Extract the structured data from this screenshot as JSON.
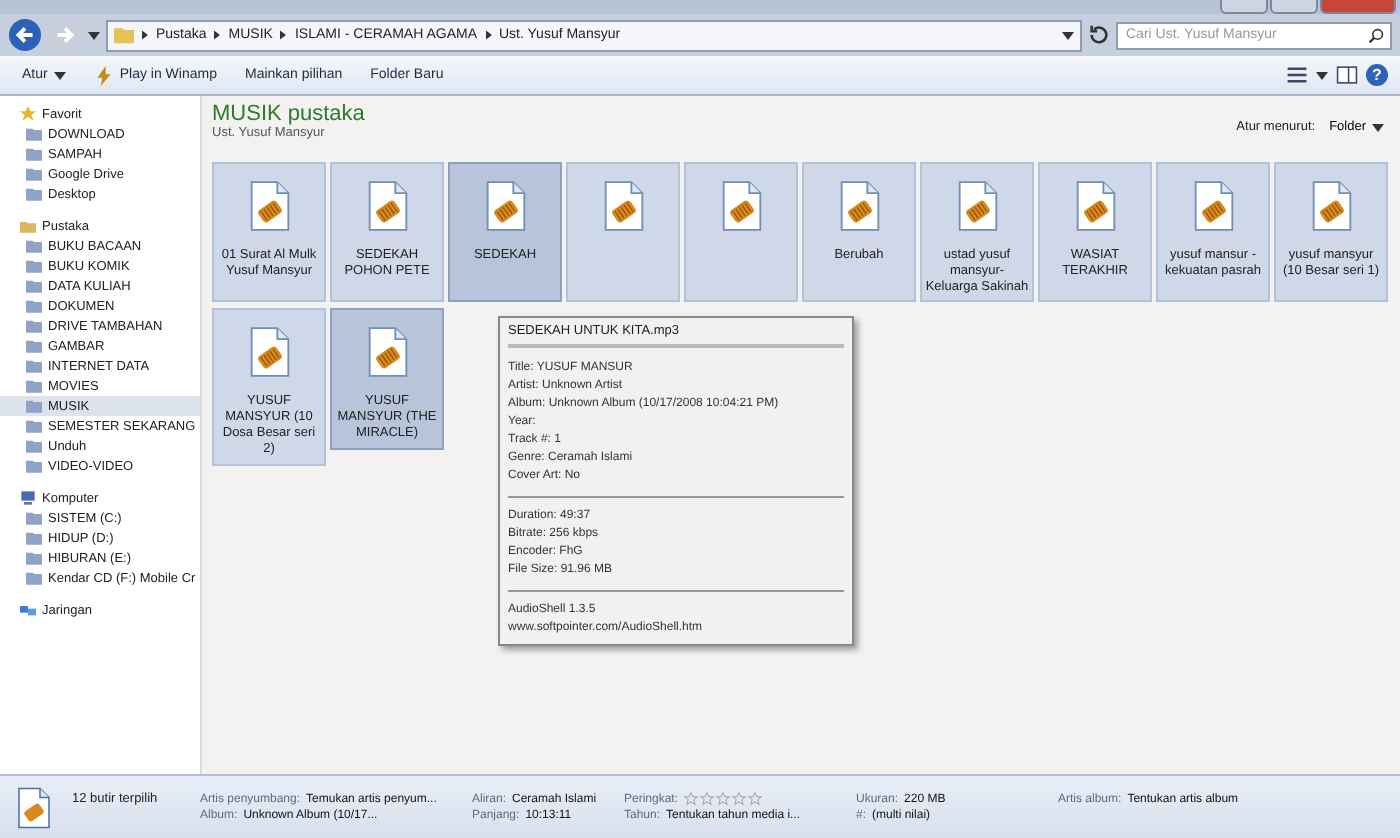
{
  "address": {
    "crumbs": [
      "Pustaka",
      "MUSIK",
      "ISLAMI - CERAMAH AGAMA",
      "Ust. Yusuf Mansyur"
    ]
  },
  "search": {
    "placeholder": "Cari Ust. Yusuf Mansyur"
  },
  "toolbar": {
    "buttons": [
      {
        "label": "Atur",
        "kind": "menu"
      },
      {
        "label": "Play in Winamp",
        "kind": "icon"
      },
      {
        "label": "Mainkan pilihan",
        "kind": "plain"
      },
      {
        "label": "Folder Baru",
        "kind": "plain"
      }
    ]
  },
  "sidebar": {
    "sections": [
      {
        "label": "Favorit",
        "kind": "star",
        "children": [
          {
            "label": "DOWNLOAD",
            "selected": false
          },
          {
            "label": "SAMPAH",
            "selected": false
          },
          {
            "label": "Google Drive",
            "selected": false
          },
          {
            "label": "Desktop",
            "selected": false
          }
        ]
      },
      {
        "label": "Pustaka",
        "kind": "library",
        "children": [
          {
            "label": "BUKU BACAAN",
            "selected": false
          },
          {
            "label": "BUKU KOMIK",
            "selected": false
          },
          {
            "label": "DATA KULIAH",
            "selected": false
          },
          {
            "label": "DOKUMEN",
            "selected": false
          },
          {
            "label": "DRIVE TAMBAHAN",
            "selected": false
          },
          {
            "label": "GAMBAR",
            "selected": false
          },
          {
            "label": "INTERNET DATA",
            "selected": false
          },
          {
            "label": "MOVIES",
            "selected": false
          },
          {
            "label": "MUSIK",
            "selected": true
          },
          {
            "label": "SEMESTER SEKARANG",
            "selected": false
          },
          {
            "label": "Unduh",
            "selected": false
          },
          {
            "label": "VIDEO-VIDEO",
            "selected": false
          }
        ]
      },
      {
        "label": "Komputer",
        "kind": "computer",
        "children": [
          {
            "label": "SISTEM (C:)",
            "selected": false
          },
          {
            "label": "HIDUP (D:)",
            "selected": false
          },
          {
            "label": "HIBURAN (E:)",
            "selected": false
          },
          {
            "label": "Kendar CD (F:) Mobile Cr",
            "selected": false
          }
        ]
      },
      {
        "label": "Jaringan",
        "kind": "network"
      }
    ]
  },
  "help": {
    "glyph": "?"
  },
  "header": {
    "title": "MUSIK pustaka",
    "subtitle": "Ust. Yusuf Mansyur",
    "sort_label": "Atur menurut:",
    "sort_value": "Folder"
  },
  "files": [
    {
      "label": "01 Surat Al Mulk Yusuf Mansyur",
      "selected": true,
      "hovered": false
    },
    {
      "label": "SEDEKAH POHON PETE",
      "selected": true,
      "hovered": false
    },
    {
      "label": "SEDEKAH",
      "selected": true,
      "hovered": true
    },
    {
      "selected": true,
      "hovered": false
    },
    {
      "selected": true,
      "hovered": false
    },
    {
      "label": "Berubah",
      "selected": true,
      "hovered": false
    },
    {
      "label": "ustad yusuf mansyur-Keluarga Sakinah",
      "selected": true,
      "hovered": false
    },
    {
      "label": "WASIAT TERAKHIR",
      "selected": true,
      "hovered": false
    },
    {
      "label": "yusuf mansur - kekuatan pasrah",
      "selected": true,
      "hovered": false
    },
    {
      "label": "yusuf mansyur (10 Besar seri 1)",
      "selected": true,
      "hovered": false
    },
    {
      "label": "YUSUF MANSYUR (10 Dosa Besar seri 2)",
      "selected": true,
      "hovered": false
    },
    {
      "label": "YUSUF MANSYUR (THE MIRACLE)",
      "selected": true,
      "hovered": true
    }
  ],
  "tooltip": {
    "title": "SEDEKAH UNTUK KITA.mp3",
    "groups": [
      [
        "Title: YUSUF MANSUR",
        "Artist: Unknown Artist",
        "Album: Unknown Album (10/17/2008 10:04:21 PM)",
        "Year:",
        "Track #: 1",
        "Genre: Ceramah Islami",
        "Cover Art: No"
      ],
      [
        "Duration: 49:37",
        "Bitrate: 256 kbps",
        "Encoder: FhG",
        "File Size: 91.96 MB"
      ],
      [
        "AudioShell 1.3.5",
        "www.softpointer.com/AudioShell.htm"
      ]
    ]
  },
  "status_bar": {
    "summary": "12 butir terpilih",
    "fields": [
      {
        "label": "Artis penyumbang:",
        "value": "Temukan artis penyum...",
        "kind": "text"
      },
      {
        "label": "Album:",
        "value": "Unknown Album (10/17...",
        "kind": "text"
      },
      {
        "label": "Aliran:",
        "value": "Ceramah Islami",
        "kind": "text"
      },
      {
        "label": "Panjang:",
        "value": "10:13:11",
        "kind": "text"
      },
      {
        "label": "Peringkat:",
        "stars": 0,
        "kind": "rating"
      },
      {
        "label": "Tahun:",
        "value": "Tentukan tahun media i...",
        "kind": "text"
      },
      {
        "label": "Ukuran:",
        "value": "220 MB",
        "kind": "text"
      },
      {
        "label": "#:",
        "value": "(multi nilai)",
        "kind": "text"
      },
      {
        "label": "Artis album:",
        "value": "Tentukan artis album",
        "kind": "text"
      }
    ]
  }
}
